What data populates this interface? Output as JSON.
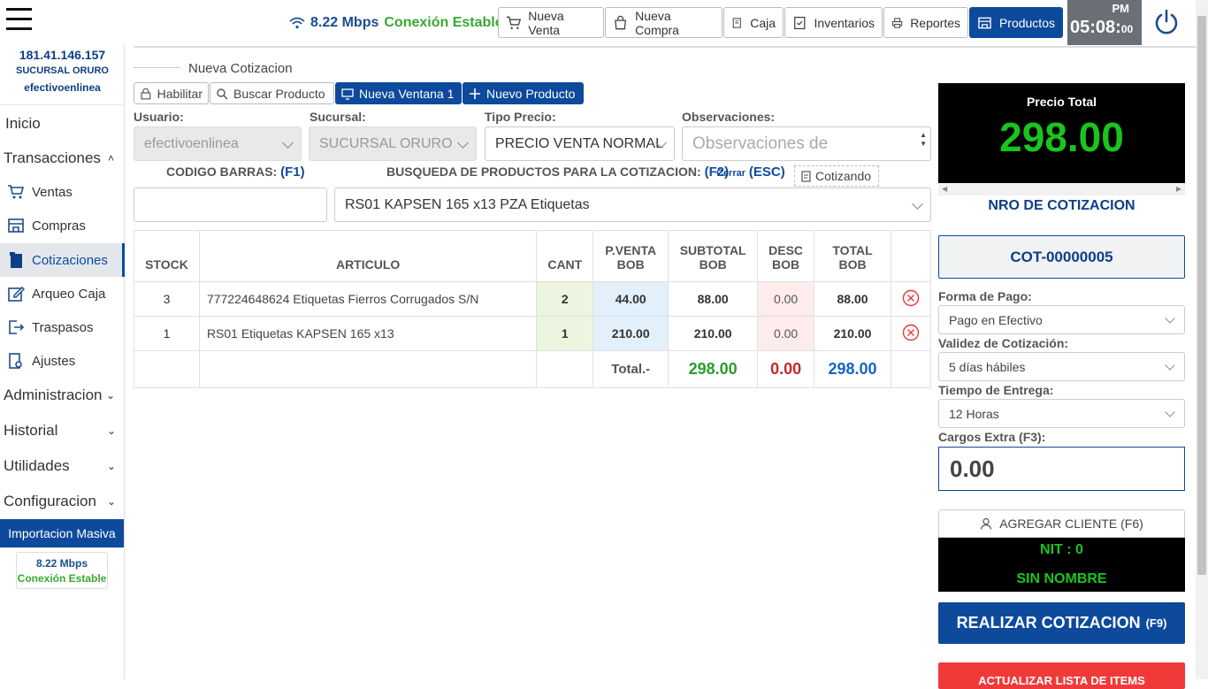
{
  "topbar": {
    "speed": "8.22 Mbps",
    "status": "Conexión Estable",
    "buttons": [
      "Nueva Venta",
      "Nueva Compra",
      "Caja",
      "Inventarios",
      "Reportes",
      "Productos"
    ],
    "clock": {
      "ampm": "PM",
      "time": "05:08:",
      "seconds": "00"
    }
  },
  "sidebar": {
    "ip": "181.41.146.157",
    "branch": "SUCURSAL ORURO",
    "user": "efectivoenlinea",
    "items": {
      "inicio": "Inicio",
      "transacciones": "Transacciones",
      "ventas": "Ventas",
      "compras": "Compras",
      "cotizaciones": "Cotizaciones",
      "arqueo": "Arqueo Caja",
      "traspasos": "Traspasos",
      "ajustes": "Ajustes",
      "administracion": "Administracion",
      "historial": "Historial",
      "utilidades": "Utilidades",
      "configuracion": "Configuracion"
    },
    "import_button": "Importacion Masiva",
    "net_speed": "8.22 Mbps",
    "net_status": "Conexión Estable"
  },
  "main": {
    "title": "Nueva Cotizacion",
    "buttons": {
      "habilitar": "Habilitar",
      "buscar": "Buscar Producto",
      "ventana": "Nueva Ventana 1",
      "nuevo": "Nuevo Producto"
    },
    "labels": {
      "usuario": "Usuario:",
      "sucursal": "Sucursal:",
      "tipo": "Tipo Precio:",
      "obs": "Observaciones:"
    },
    "values": {
      "usuario": "efectivoenlinea",
      "sucursal": "SUCURSAL ORURO",
      "tipo": "PRECIO VENTA NORMAL",
      "obs_placeholder": "Observaciones de"
    },
    "codigo_label": "CODIGO BARRAS:",
    "codigo_key": "(F1)",
    "busqueda_label": "BUSQUEDA DE PRODUCTOS PARA LA COTIZACION:",
    "busqueda_key": "(F2)",
    "cerrar_label": "Cerrar",
    "cerrar_key": "(ESC)",
    "cotizando": "Cotizando",
    "search_value": "RS01 KAPSEN 165 x13 PZA Etiquetas",
    "table": {
      "headers": {
        "stock": "STOCK",
        "articulo": "ARTICULO",
        "cant": "CANT",
        "pventa1": "P.VENTA",
        "pventa2": "BOB",
        "sub1": "SUBTOTAL",
        "sub2": "BOB",
        "desc1": "DESC",
        "desc2": "BOB",
        "tot1": "TOTAL",
        "tot2": "BOB"
      },
      "rows": [
        {
          "stock": "3",
          "articulo": "777224648624 Etiquetas Fierros Corrugados S/N",
          "cant": "2",
          "pventa": "44.00",
          "subtotal": "88.00",
          "desc": "0.00",
          "total": "88.00"
        },
        {
          "stock": "1",
          "articulo": "RS01 Etiquetas KAPSEN 165 x13",
          "cant": "1",
          "pventa": "210.00",
          "subtotal": "210.00",
          "desc": "0.00",
          "total": "210.00"
        }
      ],
      "totals": {
        "label": "Total.-",
        "subtotal": "298.00",
        "desc": "0.00",
        "total": "298.00"
      }
    }
  },
  "right": {
    "precio_label": "Precio Total",
    "precio_value": "298.00",
    "nro_label": "NRO DE COTIZACION",
    "nro_value": "COT-00000005",
    "forma_label": "Forma de Pago:",
    "forma_value": "Pago en Efectivo",
    "validez_label": "Validez de Cotización:",
    "validez_value": "5 días hábiles",
    "tiempo_label": "Tiempo de Entrega:",
    "tiempo_value": "12 Horas",
    "cargos_label": "Cargos Extra (F3):",
    "cargos_value": "0.00",
    "agregar": "AGREGAR CLIENTE (F6)",
    "nit": "NIT : 0",
    "nombre": "SIN NOMBRE",
    "realizar": "REALIZAR COTIZACION",
    "realizar_key": "(F9)",
    "actualizar": "ACTUALIZAR LISTA DE ITEMS"
  },
  "colors": {
    "primary": "#0d4a9c",
    "green": "#19c51d",
    "status_green": "#3aa832",
    "danger": "#e53935"
  }
}
